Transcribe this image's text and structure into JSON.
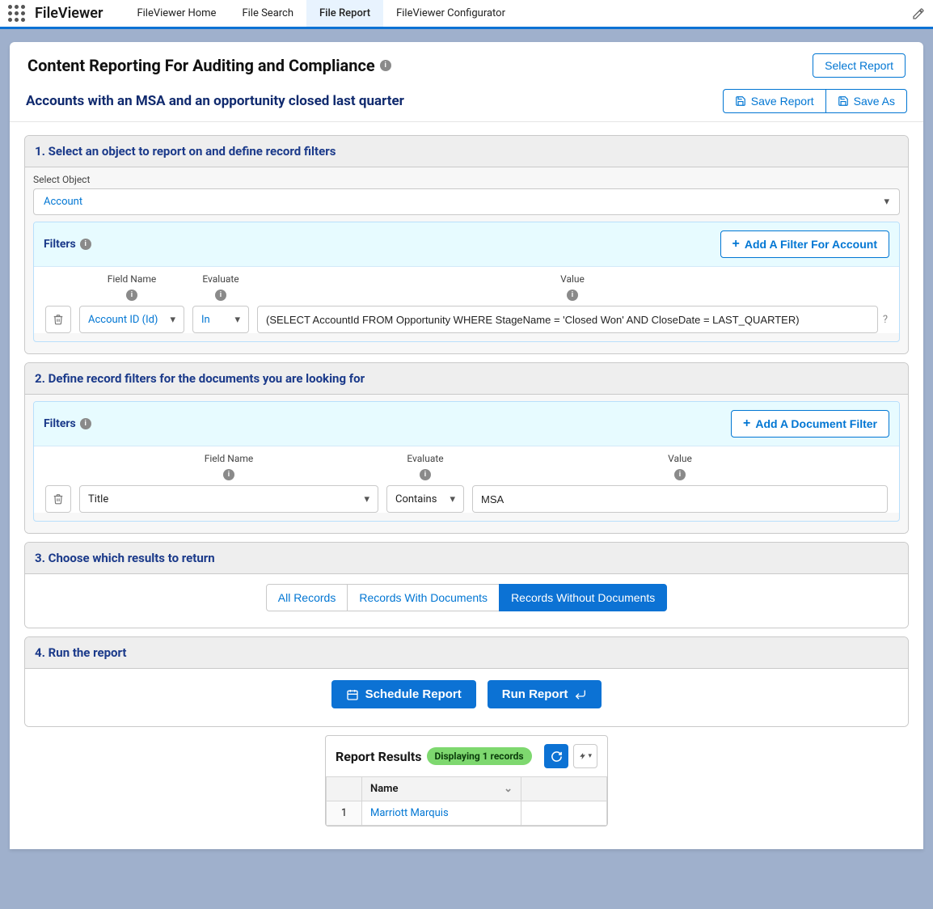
{
  "app_name": "FileViewer",
  "nav_tabs": [
    "FileViewer Home",
    "File Search",
    "File Report",
    "FileViewer Configurator"
  ],
  "nav_active_index": 2,
  "page_title": "Content Reporting For Auditing and Compliance",
  "select_report_btn": "Select Report",
  "subtitle": "Accounts with an MSA and an opportunity closed last quarter",
  "save_report_btn": "Save Report",
  "save_as_btn": "Save As",
  "step1": {
    "heading": "1. Select an object to report on and define record filters",
    "select_object_label": "Select Object",
    "object_value": "Account",
    "filters_label": "Filters",
    "add_filter_btn": "Add A Filter For Account",
    "cols": {
      "field": "Field Name",
      "evaluate": "Evaluate",
      "value": "Value"
    },
    "row": {
      "field": "Account ID (Id)",
      "evaluate": "In",
      "value": "(SELECT AccountId FROM Opportunity WHERE StageName = 'Closed Won' AND CloseDate = LAST_QUARTER)"
    }
  },
  "step2": {
    "heading": "2. Define record filters for the documents you are looking for",
    "filters_label": "Filters",
    "add_filter_btn": "Add A Document Filter",
    "cols": {
      "field": "Field Name",
      "evaluate": "Evaluate",
      "value": "Value"
    },
    "row": {
      "field": "Title",
      "evaluate": "Contains",
      "value": "MSA"
    }
  },
  "step3": {
    "heading": "3. Choose which results to return",
    "options": [
      "All Records",
      "Records With Documents",
      "Records Without Documents"
    ],
    "active_index": 2
  },
  "step4": {
    "heading": "4. Run the report",
    "schedule_btn": "Schedule Report",
    "run_btn": "Run Report"
  },
  "results": {
    "title": "Report Results",
    "pill": "Displaying 1 records",
    "col_name": "Name",
    "rows": [
      {
        "index": "1",
        "name": "Marriott Marquis"
      }
    ]
  }
}
